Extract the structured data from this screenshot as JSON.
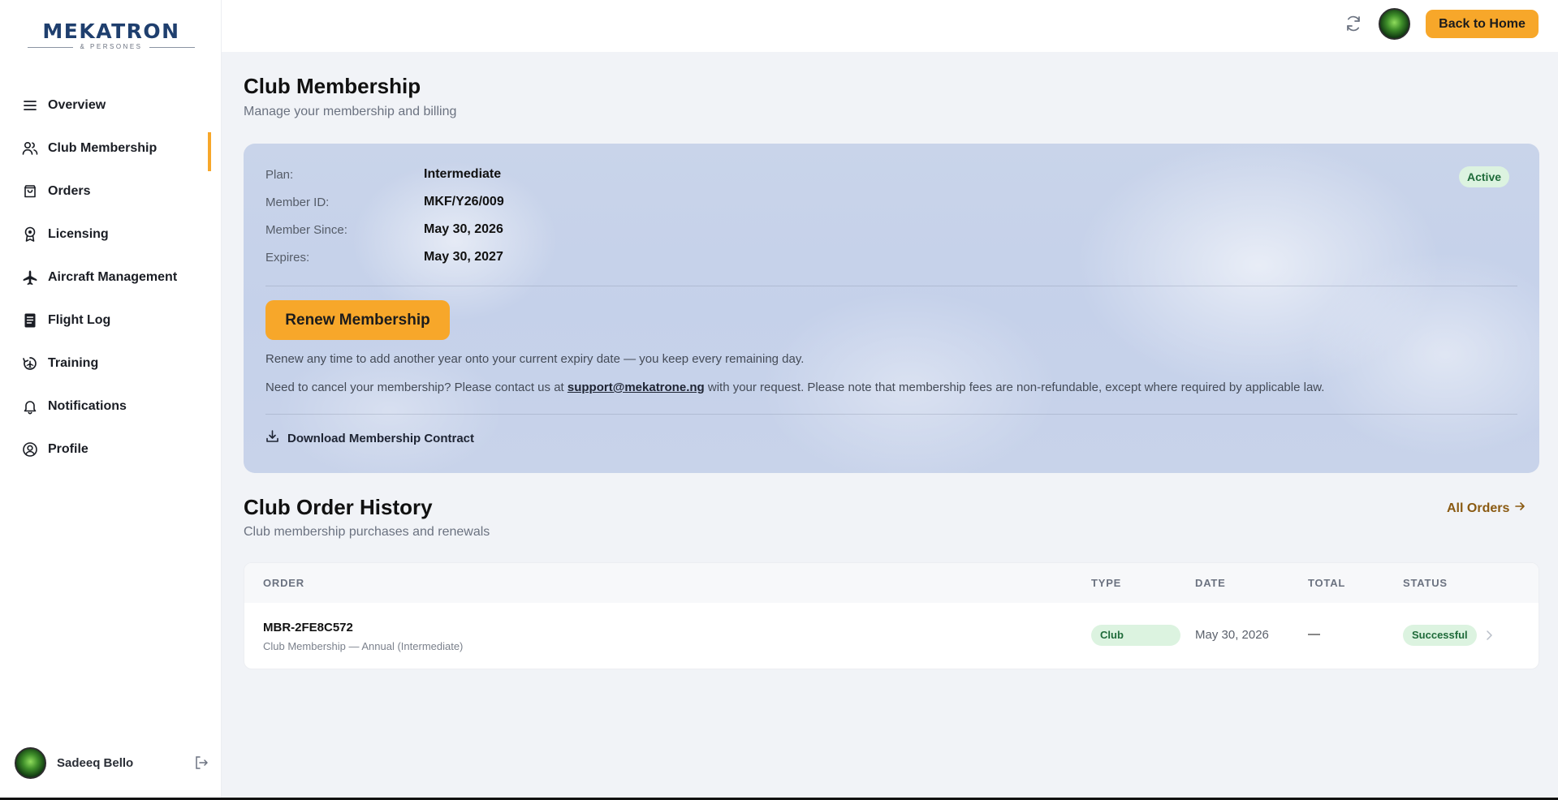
{
  "brand": {
    "name": "MEKATRON",
    "tagline": "& PERSONES"
  },
  "sidebar": {
    "items": [
      {
        "label": "Overview",
        "icon": "menu-icon"
      },
      {
        "label": "Club Membership",
        "icon": "users-icon",
        "active": true
      },
      {
        "label": "Orders",
        "icon": "shopping-bag-icon"
      },
      {
        "label": "Licensing",
        "icon": "award-icon"
      },
      {
        "label": "Aircraft Management",
        "icon": "plane-icon"
      },
      {
        "label": "Flight Log",
        "icon": "notebook-icon"
      },
      {
        "label": "Training",
        "icon": "training-icon"
      },
      {
        "label": "Notifications",
        "icon": "bell-icon"
      },
      {
        "label": "Profile",
        "icon": "user-circle-icon"
      }
    ],
    "user_name": "Sadeeq Bello"
  },
  "topbar": {
    "home_label": "Back to Home"
  },
  "page": {
    "title": "Club Membership",
    "subtitle": "Manage your membership and billing"
  },
  "membership": {
    "status": "Active",
    "details": [
      {
        "label": "Plan:",
        "value": "Intermediate"
      },
      {
        "label": "Member ID:",
        "value": "MKF/Y26/009"
      },
      {
        "label": "Member Since:",
        "value": "May 30, 2026"
      },
      {
        "label": "Expires:",
        "value": "May 30, 2027"
      }
    ],
    "renew_label": "Renew Membership",
    "renew_note": "Renew any time to add another year onto your current expiry date — you keep every remaining day.",
    "cancel_note_before": "Need to cancel your membership? Please contact us at ",
    "cancel_email": "support@mekatrone.ng",
    "cancel_note_after": " with your request. Please note that membership fees are non-refundable, except where required by applicable law.",
    "download_label": "Download Membership Contract"
  },
  "order_history": {
    "title": "Club Order History",
    "subtitle": "Club membership purchases and renewals",
    "all_orders_label": "All Orders",
    "columns": [
      "ORDER",
      "TYPE",
      "DATE",
      "TOTAL",
      "STATUS"
    ],
    "rows": [
      {
        "order": "MBR-2FE8C572",
        "description": "Club Membership — Annual (Intermediate)",
        "type": "Club",
        "date": "May 30, 2026",
        "total": "—",
        "status": "Successful"
      }
    ]
  },
  "colors": {
    "accent": "#f7a72a",
    "success_bg": "#dcf3e0",
    "success_text": "#1f6b3a",
    "brand": "#1f3f6e"
  }
}
